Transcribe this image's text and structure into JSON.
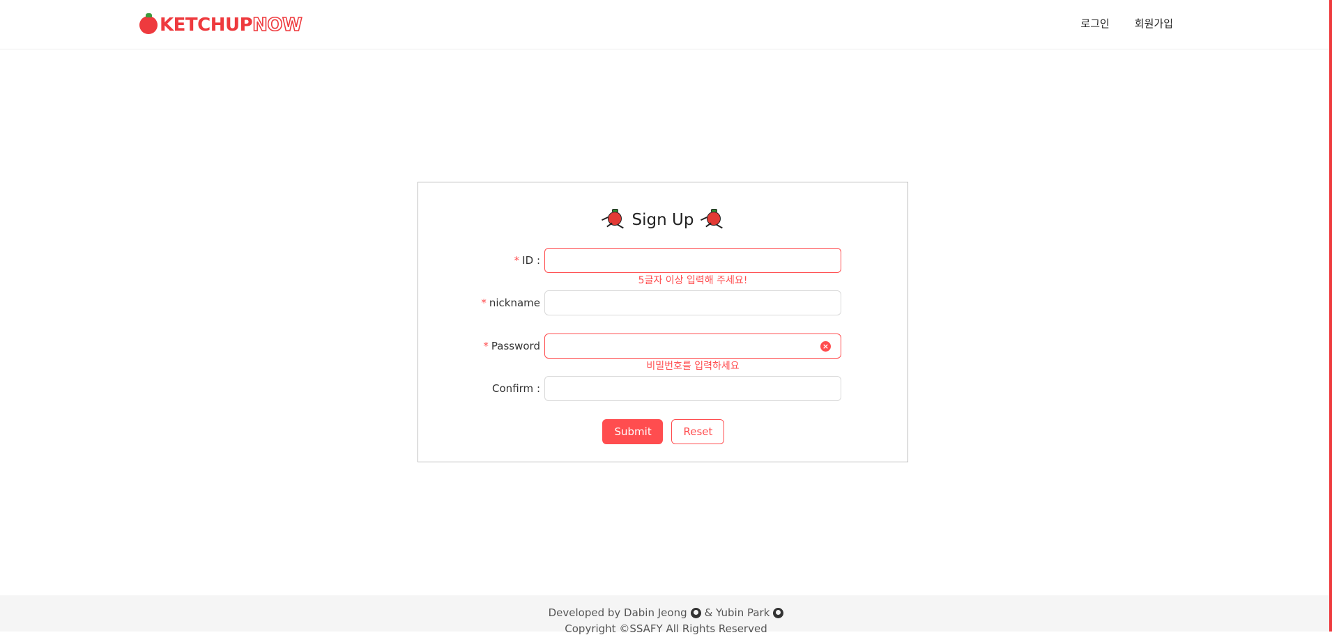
{
  "header": {
    "logo_part1": "KETCHUP",
    "logo_part2": "NOW",
    "nav": {
      "login": "로그인",
      "signup": "회원가입"
    }
  },
  "form": {
    "title": "Sign Up",
    "fields": {
      "id": {
        "label": "ID",
        "required": "*",
        "colon": ":",
        "value": "",
        "error": "5글자 이상 입력해 주세요!"
      },
      "nickname": {
        "label": "nickname",
        "required": "*",
        "value": ""
      },
      "password": {
        "label": "Password",
        "required": "*",
        "value": "",
        "error": "비밀번호를 입력하세요"
      },
      "confirm": {
        "label": "Confirm",
        "colon": ":",
        "value": ""
      }
    },
    "submit_label": "Submit",
    "reset_label": "Reset"
  },
  "footer": {
    "developed_by": "Developed by Dabin Jeong",
    "amp": "& Yubin Park",
    "copyright": "Copyright ©SSAFY All Rights Reserved"
  },
  "colors": {
    "accent": "#ff4d4f",
    "brand": "#ee3a3e"
  }
}
